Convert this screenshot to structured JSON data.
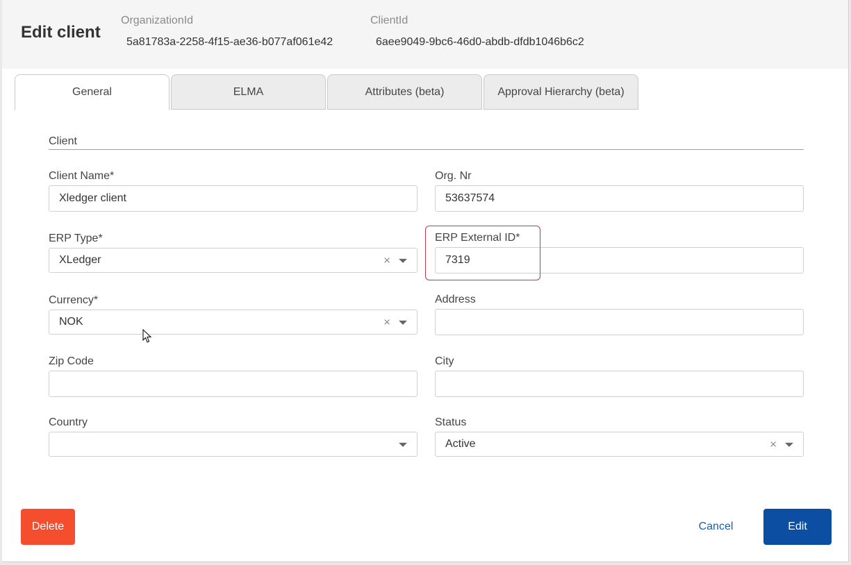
{
  "header": {
    "title": "Edit client",
    "organization_id_label": "OrganizationId",
    "organization_id_value": "5a81783a-2258-4f15-ae36-b077af061e42",
    "client_id_label": "ClientId",
    "client_id_value": "6aee9049-9bc6-46d0-abdb-dfdb1046b6c2"
  },
  "tabs": [
    {
      "label": "General",
      "active": true
    },
    {
      "label": "ELMA"
    },
    {
      "label": "Attributes (beta)"
    },
    {
      "label": "Approval Hierarchy (beta)"
    }
  ],
  "section": {
    "title": "Client"
  },
  "fields": {
    "client_name": {
      "label": "Client Name*",
      "value": "Xledger client"
    },
    "org_nr": {
      "label": "Org. Nr",
      "value": "53637574"
    },
    "erp_type": {
      "label": "ERP Type*",
      "value": "XLedger"
    },
    "erp_external_id": {
      "label": "ERP External ID*",
      "value": "7319"
    },
    "currency": {
      "label": "Currency*",
      "value": "NOK"
    },
    "address": {
      "label": "Address",
      "value": ""
    },
    "zip_code": {
      "label": "Zip Code",
      "value": ""
    },
    "city": {
      "label": "City",
      "value": ""
    },
    "country": {
      "label": "Country",
      "value": ""
    },
    "status": {
      "label": "Status",
      "value": "Active"
    }
  },
  "icons": {
    "clear": "×"
  },
  "buttons": {
    "delete": "Delete",
    "cancel": "Cancel",
    "edit": "Edit"
  },
  "colors": {
    "delete": "#f44e2f",
    "primary": "#0b4ea2",
    "link": "#1a5fa8",
    "highlight": "#c0394b"
  }
}
